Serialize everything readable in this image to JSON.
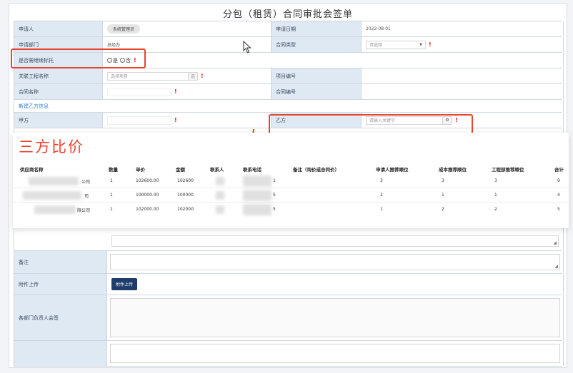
{
  "form": {
    "title": "分包（租赁）合同审批会签单",
    "applicant_label": "申请人",
    "applicant_value": "系统管理员",
    "apply_date_label": "申请日期",
    "apply_date_value": "2022-08-01",
    "dept_label": "申请部门",
    "dept_value": "总经办",
    "contract_type_label": "合同类型",
    "contract_type_placeholder": "请选择",
    "is_bid_label": "是否需继续标托",
    "radio_yes": "是",
    "radio_no": "否",
    "project_label": "关联工程名称",
    "project_placeholder": "选择项目",
    "project_btn": "选",
    "project_no_label": "项目编号",
    "contract_name_label": "合同名称",
    "contract_no_label": "合同编号",
    "add_party_link": "新建乙方信息",
    "party_a_label": "甲方",
    "party_b_label": "乙方",
    "party_b_placeholder": "请输入关键字",
    "remark_label": "备注",
    "attach_label": "附件上传",
    "attach_btn": "附件上传",
    "sign_label": "各部门负责人会签",
    "required_mark": "!"
  },
  "overlay": {
    "title": "三方比价",
    "headers": [
      "供应商名称",
      "数量",
      "单价",
      "金额",
      "联系人",
      "联系电话",
      "备注（询价或合同价）",
      "申请人推荐顺位",
      "成本推荐顺位",
      "工程部推荐顺位",
      "合计"
    ],
    "rows": [
      {
        "name_suffix": "公司",
        "qty": "1",
        "price": "102600.00",
        "amount": "102600",
        "remark_digit": "1",
        "rank1": "3",
        "rank2": "3",
        "rank3": "3",
        "total": "9"
      },
      {
        "name_suffix": "司",
        "qty": "1",
        "price": "100000.00",
        "amount": "100000",
        "remark_digit": "5",
        "rank1": "2",
        "rank2": "1",
        "rank3": "1",
        "total": "4"
      },
      {
        "name_suffix": "限公司",
        "qty": "1",
        "price": "102000.00",
        "amount": "102000",
        "remark_digit": "5",
        "rank1": "1",
        "rank2": "2",
        "rank3": "2",
        "total": "5"
      }
    ]
  },
  "colors": {
    "label_bg": "#dfe9f3",
    "highlight": "#e8432d",
    "primary_btn": "#1f3d6b",
    "link": "#2d7fd6"
  }
}
